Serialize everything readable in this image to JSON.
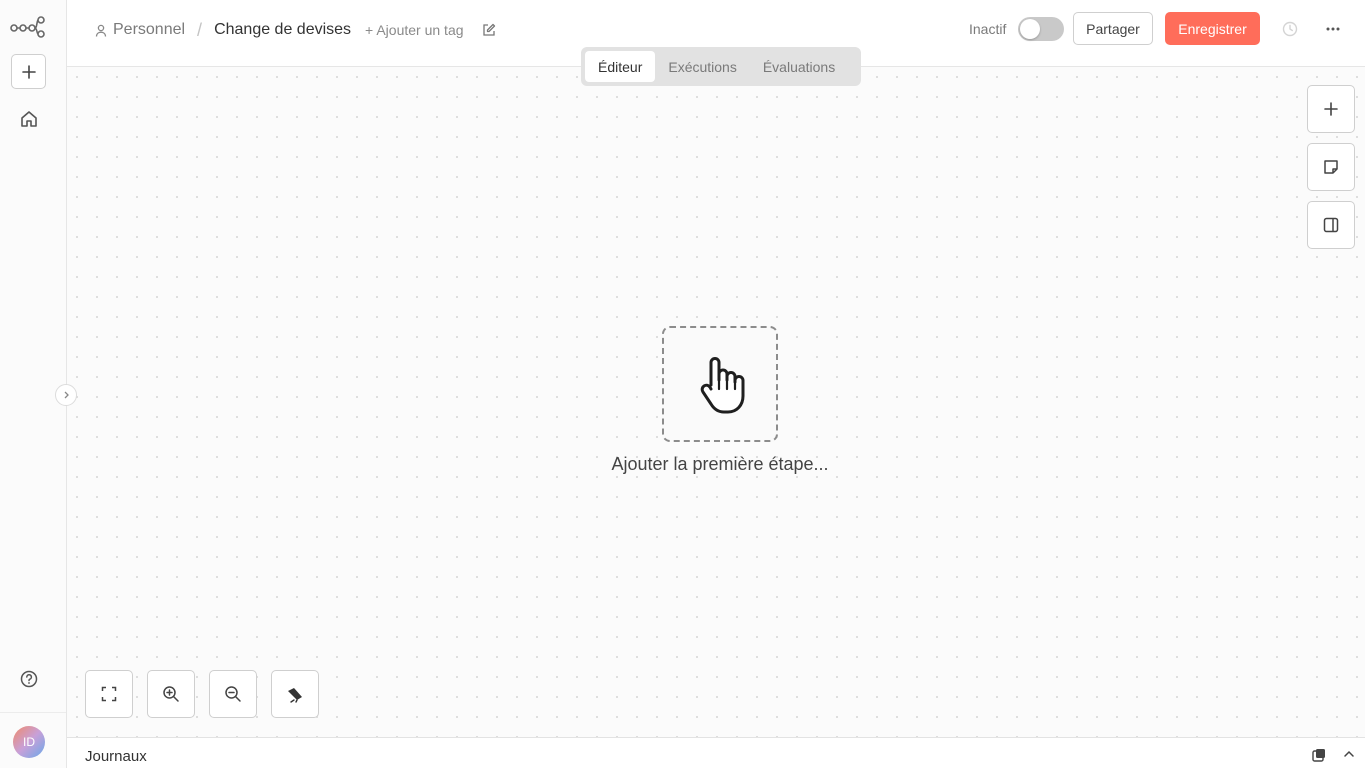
{
  "sidebar": {
    "logo_icon": "n8n-logo-icon",
    "add_icon": "plus-icon",
    "home_icon": "home-icon",
    "help_icon": "help-circle-icon",
    "expand_icon": "chevron-right-icon",
    "avatar_initials": "ID"
  },
  "header": {
    "project": "Personnel",
    "separator": "/",
    "workflow_title": "Change de devises",
    "add_tag": "+ Ajouter un tag",
    "status_label": "Inactif",
    "active": false,
    "share_label": "Partager",
    "save_label": "Enregistrer",
    "save_color": "#ff6d5a"
  },
  "tabs": [
    {
      "label": "Éditeur",
      "active": true
    },
    {
      "label": "Exécutions",
      "active": false
    },
    {
      "label": "Évaluations",
      "active": false
    }
  ],
  "canvas": {
    "add_first_step_label": "Ajouter la première étape...",
    "right_tools": [
      "plus-icon",
      "sticky-note-icon",
      "side-panel-icon"
    ],
    "zoom_tools": [
      "fit-view-icon",
      "zoom-in-icon",
      "zoom-out-icon",
      "tidy-up-icon"
    ]
  },
  "logs": {
    "label": "Journaux"
  }
}
